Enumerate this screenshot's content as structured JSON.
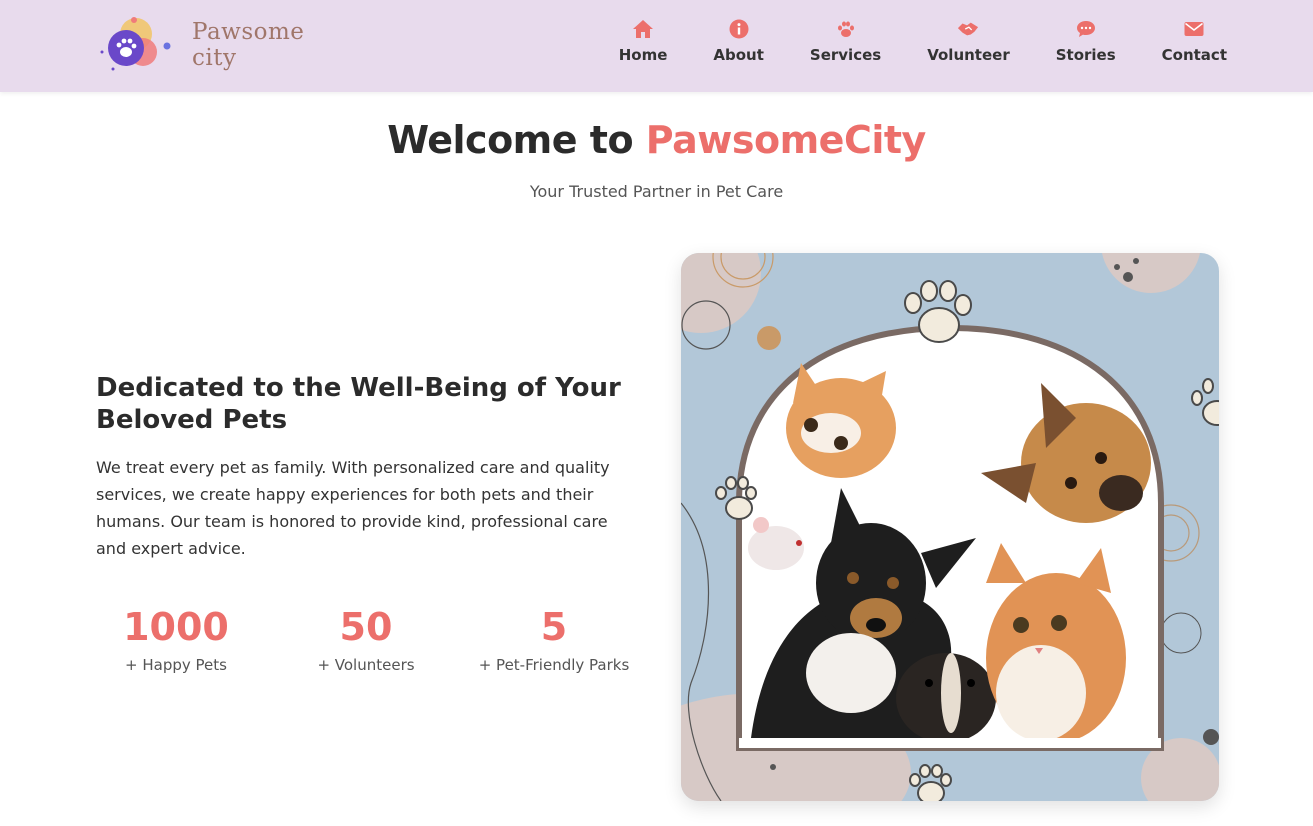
{
  "brand": {
    "name": "Pawsome city"
  },
  "nav": {
    "items": [
      {
        "label": "Home",
        "icon": "home-icon"
      },
      {
        "label": "About",
        "icon": "info-icon"
      },
      {
        "label": "Services",
        "icon": "paw-icon"
      },
      {
        "label": "Volunteer",
        "icon": "handshake-icon"
      },
      {
        "label": "Stories",
        "icon": "chat-icon"
      },
      {
        "label": "Contact",
        "icon": "envelope-icon"
      }
    ],
    "icon_color": "#ec6f6b"
  },
  "hero": {
    "title_prefix": "Welcome to",
    "title_accent": "PawsomeCity",
    "subtitle": "Your Trusted Partner in Pet Care"
  },
  "about": {
    "heading": "Dedicated to the Well-Being of Your Beloved Pets",
    "body": "We treat every pet as family. With personalized care and quality services, we create happy experiences for both pets and their humans. Our team is honored to provide kind, professional care and expert advice."
  },
  "stats": [
    {
      "value": "1000",
      "label": "+ Happy Pets"
    },
    {
      "value": "50",
      "label": "+ Volunteers"
    },
    {
      "value": "5",
      "label": "+ Pet-Friendly Parks"
    }
  ],
  "colors": {
    "header_bg": "#e8dbed",
    "accent": "#ec6f6b",
    "card_bg": "#b2c7d8"
  }
}
